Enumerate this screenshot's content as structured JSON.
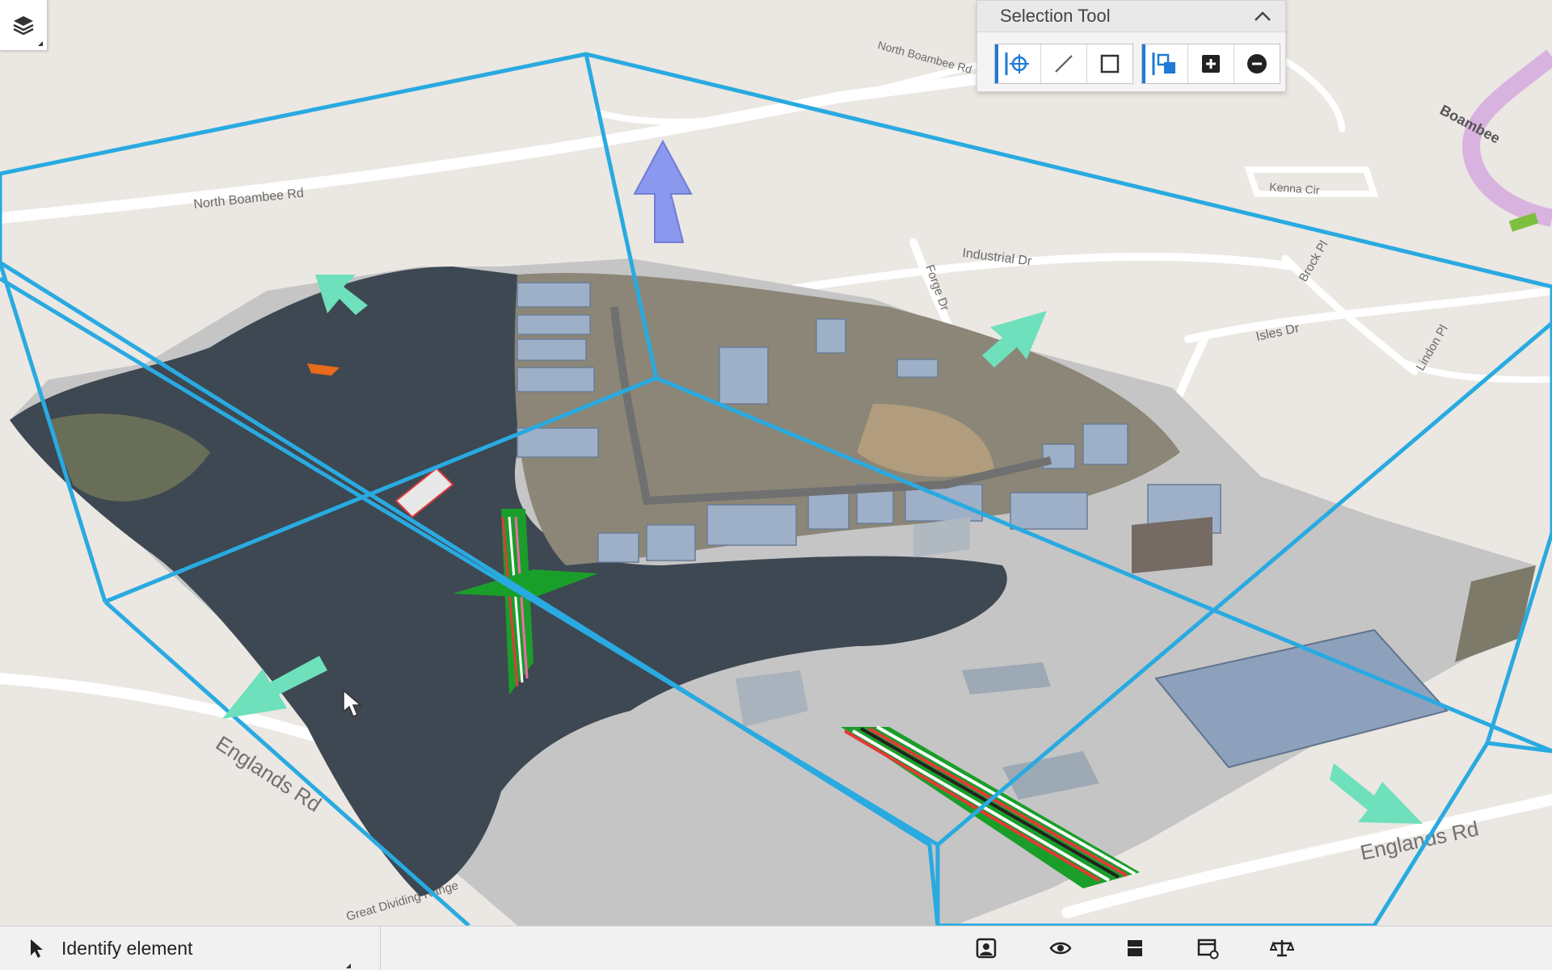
{
  "app": {
    "toolbar_title": "Selection Tool"
  },
  "colors": {
    "map_bg": "#ebe7e2",
    "road": "#ffffff",
    "selection_box": "#29aae1",
    "arrow_green": "#6ee0bb",
    "arrow_blue": "#8a98ee",
    "accent": "#1f7ad6",
    "highway": "#d9b3df"
  },
  "icons": {
    "layers": "layers-icon",
    "tool_point": "point-select-icon",
    "tool_line": "line-select-icon",
    "tool_rect": "rectangle-select-icon",
    "mode_replace": "replace-selection-icon",
    "mode_add": "add-selection-icon",
    "mode_remove": "remove-selection-icon",
    "collapse": "chevron-up-icon",
    "identify": "pointer-icon"
  },
  "map": {
    "road_labels": {
      "north_road": "North Boambee Rd",
      "industrial": "Industrial Dr",
      "isles": "Isles Dr",
      "forge": "Forge Dr",
      "englands_left": "Englands Rd",
      "englands_right": "Englands Rd",
      "great_dividing": "Great Dividing Range",
      "kenna": "Kenna Cir",
      "boambee": "Boambee",
      "north_boambee_top": "North Boambee Rd",
      "brock": "Brock Pl",
      "lindon": "Lindon Pl"
    }
  },
  "status_bar": {
    "identify_label": "Identify element",
    "icons": [
      "reality-data-icon",
      "eye-icon",
      "section-icon",
      "window-settings-icon",
      "measure-icon"
    ]
  }
}
